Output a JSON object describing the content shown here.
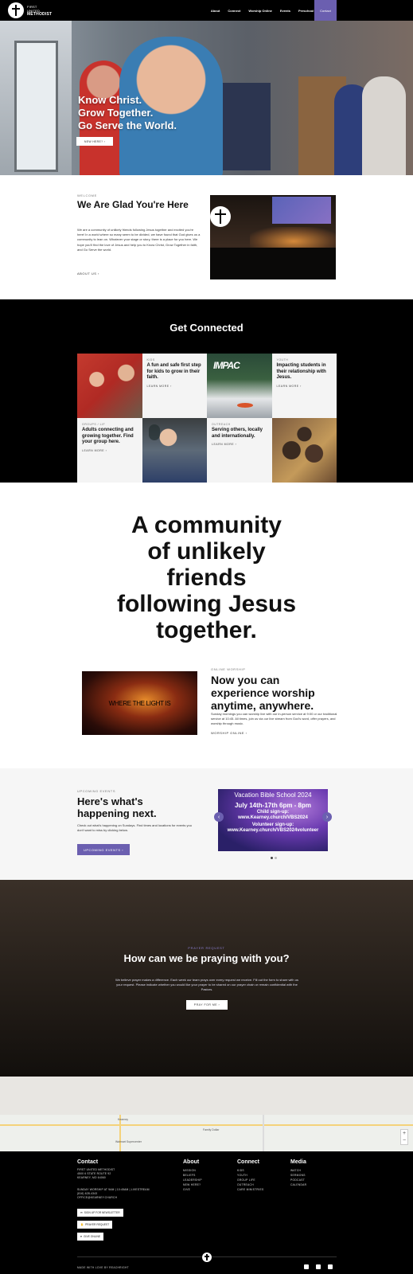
{
  "nav": {
    "logo_line1": "FIRST",
    "logo_line2": "UNITED",
    "logo_line3": "METHODIST",
    "links": [
      "About",
      "Connect",
      "Worship Online",
      "Events",
      "Preschool",
      "Give"
    ],
    "cta": "Contact"
  },
  "hero": {
    "title_line1": "Know Christ.",
    "title_line2": "Grow Together.",
    "title_line3": "Go Serve the World.",
    "button": "NEW HERE? ›"
  },
  "welcome": {
    "eyebrow": "WELCOME",
    "title": "We Are Glad You're Here",
    "body": "We are a community of unlikely friends following Jesus together and excited you're here! In a world where so many seem to be divided, we have found that God gives us a community to lean on. Whatever your stage or story, there is a place for you here. We hope you'll find the love of Jesus and help you to Know Christ, Grow Together in faith, and Go Serve the world.",
    "link": "ABOUT US ›",
    "image_caption": "Sunday worship"
  },
  "connected": {
    "title": "Get Connected",
    "cells": [
      {
        "eyebrow": "KIDS",
        "heading": "A fun and safe first step for kids to grow in their faith.",
        "link": "LEARN MORE ›"
      },
      {
        "eyebrow": "YOUTH",
        "heading": "Impacting students in their relationship with Jesus.",
        "link": "LEARN MORE ›"
      },
      {
        "eyebrow": "GROUPS / LIF",
        "heading": "Adults connecting and growing together. Find your group here.",
        "link": "LEARN MORE ›"
      },
      {
        "eyebrow": "OUTREACH",
        "heading": "Serving others, locally and internationally.",
        "link": "LEARN MORE ›"
      }
    ],
    "impact_logo": "IMPAC"
  },
  "statement": {
    "line1": "A community",
    "line2": "of unlikely",
    "line3": "friends",
    "line4": "following Jesus",
    "line5": "together."
  },
  "worship": {
    "image_text": "WHERE THE LIGHT IS",
    "eyebrow": "ONLINE WORSHIP",
    "title": "Now you can experience worship anytime, anywhere.",
    "body": "Sunday mornings you can worship live with our in-person service at 9:00 or our traditional service at 10:45. All times, join us via our live stream from God's word, offer prayers, and worship through music.",
    "link": "WORSHIP ONLINE ›"
  },
  "events": {
    "eyebrow": "UPCOMING EVENTS",
    "title": "Here's what's happening next.",
    "body": "Check out what's happening on Sundays. Find times and locations for events you don't want to miss by clicking below.",
    "button": "UPCOMING EVENTS ›",
    "vbs_title": "Vacation Bible School 2024",
    "vbs_dates": "July 14th-17th 6pm - 8pm",
    "vbs_child_label": "Child sign-up:",
    "vbs_child_url": "www.Kearney.church/VBS2024",
    "vbs_vol_label": "Volunteer sign-up:",
    "vbs_vol_url": "www.Kearney.church/VBS2024volunteer"
  },
  "prayer": {
    "eyebrow": "PRAYER REQUEST",
    "title": "How can we be praying with you?",
    "body": "We believe prayer makes a difference. Each week our team prays over every request we receive. Fill out the form to share with us your request. Please indicate whether you would like your prayer to be shared on our prayer chain or remain confidential with the Pastors.",
    "button": "PRAY FOR ME ›"
  },
  "map": {
    "labels": [
      "Kearney",
      "Family Dollar",
      "Walmart Supercenter"
    ]
  },
  "footer": {
    "contact_title": "Contact",
    "contact_lines": [
      "FIRST UNITED METHODIST",
      "4500 6 STATE ROUTE 92",
      "KEARNEY, MO 64060"
    ],
    "worship_lines": [
      "SUNDAY WORSHIP AT 9AM | 10:45AM | LIVESTREAM",
      "(816) 628-4343",
      "OFFICE@KEARNEY.CHURCH"
    ],
    "buttons": [
      "SIGN UP FOR NEWSLETTER",
      "PRAYER REQUEST",
      "GIVE ONLINE"
    ],
    "about_title": "About",
    "about_items": [
      "MISSION",
      "BELIEFS",
      "LEADERSHIP",
      "NEW HERE?",
      "GIVE"
    ],
    "connect_title": "Connect",
    "connect_items": [
      "KIDS",
      "YOUTH",
      "GROUP LIFE",
      "OUTREACH",
      "CARE MINISTRIES"
    ],
    "media_title": "Media",
    "media_items": [
      "WATCH",
      "SERMONS",
      "PODCAST",
      "CALENDAR"
    ],
    "made": "MADE WITH LOVE BY REACHRIGHT",
    "social": [
      "facebook-icon",
      "instagram-icon",
      "vimeo-icon"
    ]
  }
}
